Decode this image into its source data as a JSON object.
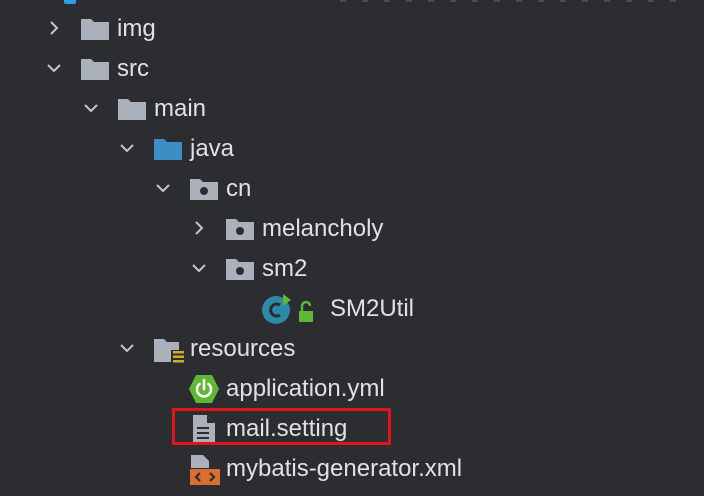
{
  "tree": {
    "items": [
      {
        "label": "img",
        "expanded": false,
        "icon": "folder-icon"
      },
      {
        "label": "src",
        "expanded": true,
        "icon": "folder-icon"
      },
      {
        "label": "main",
        "expanded": true,
        "icon": "folder-icon"
      },
      {
        "label": "java",
        "expanded": true,
        "icon": "source-root-folder-icon"
      },
      {
        "label": "cn",
        "expanded": true,
        "icon": "package-icon"
      },
      {
        "label": "melancholy",
        "expanded": false,
        "icon": "package-icon"
      },
      {
        "label": "sm2",
        "expanded": true,
        "icon": "package-icon"
      },
      {
        "label": "SM2Util",
        "icon": "java-class-icon"
      },
      {
        "label": "resources",
        "expanded": true,
        "icon": "resources-folder-icon"
      },
      {
        "label": "application.yml",
        "icon": "spring-boot-icon"
      },
      {
        "label": "mail.setting",
        "icon": "text-file-icon"
      },
      {
        "label": "mybatis-generator.xml",
        "icon": "xml-file-icon"
      }
    ]
  },
  "highlight": {
    "target": "mail.setting",
    "color": "#e2141b"
  },
  "colors": {
    "background": "#2b2d30",
    "text": "#dfe1e5",
    "folder": "#abb1bb",
    "source_root": "#3d8fc3",
    "spring": "#5fb832",
    "xml": "#d86e2f",
    "class": "#2d8aa8"
  }
}
